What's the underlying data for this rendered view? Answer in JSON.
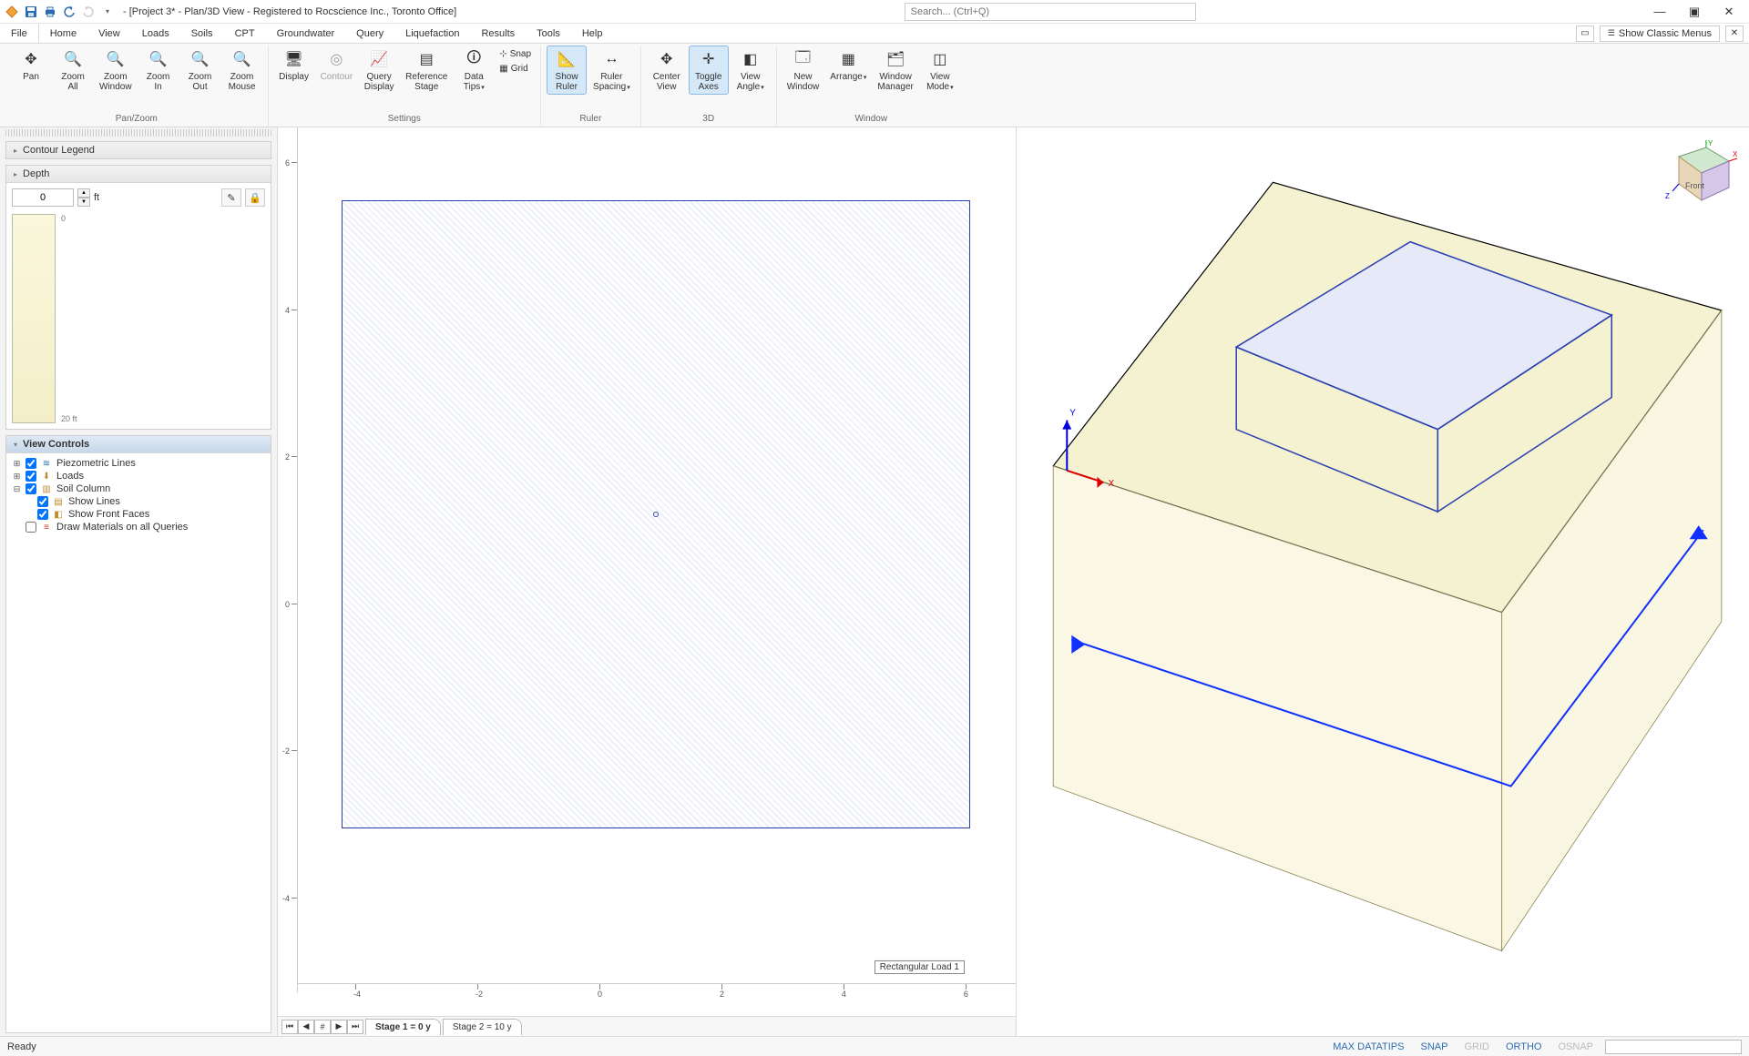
{
  "title": "- [Project 3* - Plan/3D View - Registered to Rocscience Inc., Toronto Office]",
  "search_placeholder": "Search... (Ctrl+Q)",
  "classic_menus": "Show Classic Menus",
  "menus": [
    "File",
    "Home",
    "View",
    "Loads",
    "Soils",
    "CPT",
    "Groundwater",
    "Query",
    "Liquefaction",
    "Results",
    "Tools",
    "Help"
  ],
  "active_menu": "View",
  "ribbon": {
    "panzoom": {
      "label": "Pan/Zoom",
      "pan": "Pan",
      "zoom_all": "Zoom\nAll",
      "zoom_window": "Zoom\nWindow",
      "zoom_in": "Zoom\nIn",
      "zoom_out": "Zoom\nOut",
      "zoom_mouse": "Zoom\nMouse"
    },
    "settings": {
      "label": "Settings",
      "display": "Display",
      "contour": "Contour",
      "query_display": "Query\nDisplay",
      "ref_stage": "Reference\nStage",
      "data_tips": "Data\nTips",
      "snap": "Snap",
      "grid": "Grid"
    },
    "ruler": {
      "label": "Ruler",
      "show_ruler": "Show\nRuler",
      "ruler_spacing": "Ruler\nSpacing"
    },
    "threeD": {
      "label": "3D",
      "center_view": "Center\nView",
      "toggle_axes": "Toggle\nAxes",
      "view_angle": "View\nAngle"
    },
    "window": {
      "label": "Window",
      "new_window": "New\nWindow",
      "arrange": "Arrange",
      "window_manager": "Window\nManager",
      "view_mode": "View\nMode"
    }
  },
  "sidebar": {
    "contour_legend": "Contour Legend",
    "depth": "Depth",
    "depth_value": "0",
    "depth_unit": "ft",
    "depth_scale_top": "0",
    "depth_scale_bottom": "20 ft",
    "view_controls": "View Controls",
    "tree": {
      "piezo": "Piezometric Lines",
      "loads": "Loads",
      "soil_column": "Soil Column",
      "show_lines": "Show Lines",
      "show_front_faces": "Show Front Faces",
      "draw_materials": "Draw Materials on all Queries"
    }
  },
  "plan": {
    "load_label": "Rectangular Load 1",
    "yticks": [
      "6",
      "4",
      "2",
      "0",
      "-2",
      "-4"
    ],
    "xticks": [
      "-4",
      "-2",
      "0",
      "2",
      "4",
      "6"
    ]
  },
  "stage": {
    "tab1": "Stage 1 = 0 y",
    "tab2": "Stage 2 = 10 y"
  },
  "status": {
    "ready": "Ready",
    "max_datatips": "MAX DATATIPS",
    "snap": "SNAP",
    "grid": "GRID",
    "ortho": "ORTHO",
    "osnap": "OSNAP"
  },
  "gizmo": {
    "front": "Front",
    "x": "X",
    "y": "Y",
    "z": "Z"
  },
  "axis3d": {
    "x": "X",
    "y": "Y"
  }
}
